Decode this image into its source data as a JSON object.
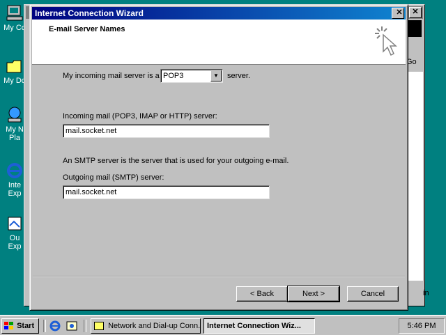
{
  "desktop": {
    "icons": [
      {
        "label": "My Co"
      },
      {
        "label": "My Do"
      },
      {
        "label": "My N\nPla"
      },
      {
        "label": "Inte\nExp"
      },
      {
        "label": "Ou\nExp"
      }
    ]
  },
  "background_window": {
    "go_label": "Go",
    "edge_label": "in"
  },
  "wizard": {
    "title": "Internet Connection Wizard",
    "close_glyph": "✕",
    "header_title": "E-mail Server Names",
    "incoming_type_prefix": "My incoming mail server is a",
    "incoming_type_value": "POP3",
    "incoming_type_suffix": "server.",
    "incoming_label": "Incoming mail (POP3, IMAP or HTTP) server:",
    "incoming_value": "mail.socket.net",
    "smtp_note": "An SMTP server is the server that is used for your outgoing e-mail.",
    "outgoing_label": "Outgoing mail (SMTP) server:",
    "outgoing_value": "mail.socket.net",
    "back_label": "< Back",
    "next_label": "Next >",
    "cancel_label": "Cancel"
  },
  "taskbar": {
    "start_label": "Start",
    "items": [
      {
        "label": "Network and Dial-up Conn..."
      },
      {
        "label": "Internet Connection Wiz..."
      }
    ],
    "clock": "5:46 PM"
  },
  "colors": {
    "desktop": "#008080",
    "title_active": "#000080",
    "face": "#c0c0c0"
  }
}
